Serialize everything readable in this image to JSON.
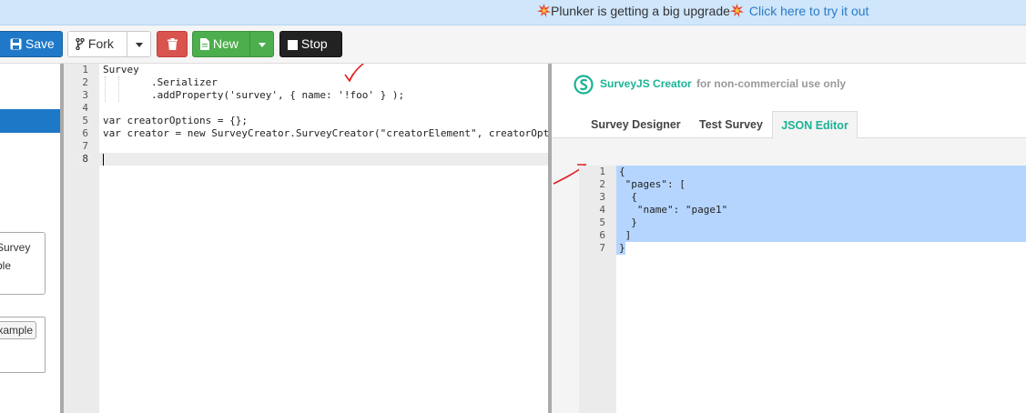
{
  "banner": {
    "text": "Plunker is getting a big upgrade",
    "link": "Click here to try it out"
  },
  "toolbar": {
    "save_label": "Save",
    "fork_label": "Fork",
    "new_label": "New",
    "stop_label": "Stop"
  },
  "left_panel": {
    "textarea_lines": [
      "Survey",
      "ble"
    ],
    "example_button": "xample"
  },
  "code_editor": {
    "lines": [
      {
        "n": "1",
        "code": "Survey"
      },
      {
        "n": "2",
        "code": "        .Serializer"
      },
      {
        "n": "3",
        "code": "        .addProperty('survey', { name: '!foo' } );"
      },
      {
        "n": "4",
        "code": ""
      },
      {
        "n": "5",
        "code": "var creatorOptions = {};"
      },
      {
        "n": "6",
        "code": "var creator = new SurveyCreator.SurveyCreator(\"creatorElement\", creatorOpt"
      },
      {
        "n": "7",
        "code": ""
      },
      {
        "n": "8",
        "code": ""
      }
    ]
  },
  "preview": {
    "brand": "SurveyJS Creator",
    "note": "for non-commercial use only",
    "tabs": [
      "Survey Designer",
      "Test Survey",
      "JSON Editor"
    ],
    "active_tab": "JSON Editor",
    "accent_color": "#1ab394",
    "json_lines": [
      {
        "n": "1",
        "code": "{"
      },
      {
        "n": "2",
        "code": " \"pages\": ["
      },
      {
        "n": "3",
        "code": "  {"
      },
      {
        "n": "4",
        "code": "   \"name\": \"page1\""
      },
      {
        "n": "5",
        "code": "  }"
      },
      {
        "n": "6",
        "code": " ]"
      },
      {
        "n": "7",
        "code": "}"
      }
    ]
  },
  "colors": {
    "save": "#1f78c8",
    "delete": "#d9534f",
    "new": "#4cae4c",
    "stop": "#222222",
    "selection": "#b5d5ff",
    "annotation": "#e02020"
  }
}
